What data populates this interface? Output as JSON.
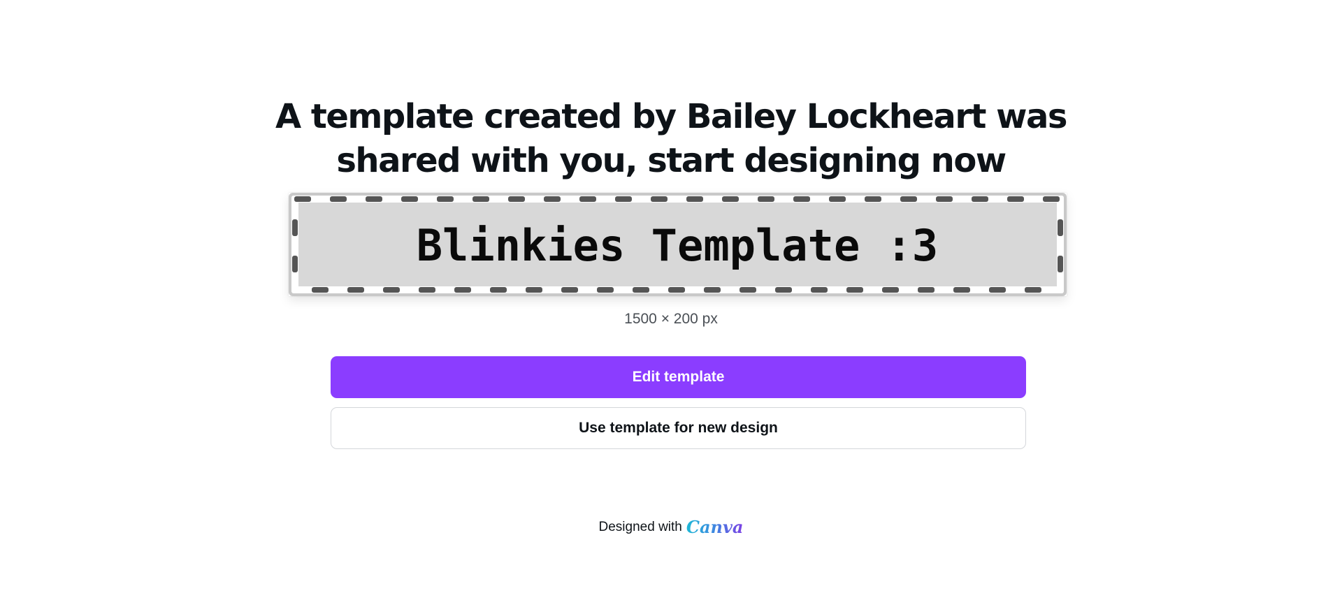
{
  "header": {
    "line1": "A template created by Bailey Lockheart was",
    "line2": "shared with you, start designing now"
  },
  "preview": {
    "title": "Blinkies Template :3",
    "dimensions": "1500 × 200 px",
    "colors": {
      "outer_frame": "#c9c9c9",
      "border_track": "#ffffff",
      "dash": "#555555",
      "fill": "#d8d8d8",
      "text": "#0a0a0a"
    }
  },
  "actions": {
    "edit_label": "Edit template",
    "use_label": "Use template for new design"
  },
  "footer": {
    "designed_with": "Designed with",
    "brand": "Canva"
  },
  "colors": {
    "accent": "#8b3dff",
    "text": "#0e1318"
  }
}
